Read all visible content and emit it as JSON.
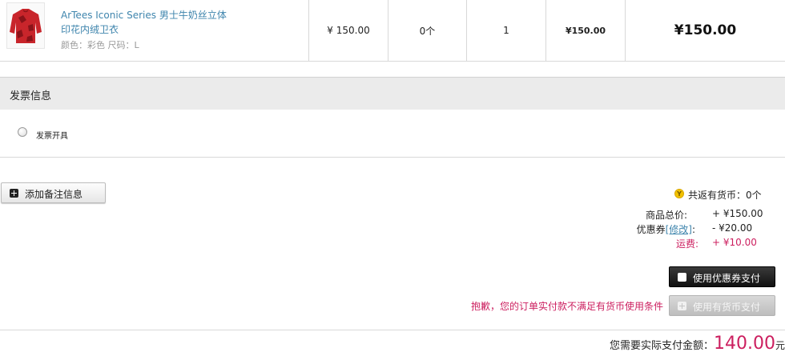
{
  "product": {
    "name": "ArTees Iconic Series 男士牛奶丝立体印花内绒卫衣",
    "color_label": "颜色：",
    "color_value": "彩色",
    "size_label": "尺码：",
    "size_value": "L",
    "price": "¥ 150.00",
    "coins": "0个",
    "quantity": "1",
    "subtotal": "¥150.00",
    "total": "¥150.00"
  },
  "invoice": {
    "title": "发票信息",
    "option_label": "发票开具"
  },
  "remark_button": "添加备注信息",
  "summary": {
    "coin_icon_text": "Y",
    "coin_return": "共返有货币：0个",
    "goods_total_label": "商品总价:",
    "goods_total_value": "+ ¥150.00",
    "coupon_label_pre": "优惠券",
    "coupon_edit": "[修改]",
    "coupon_label_post": ":",
    "coupon_value": "- ¥20.00",
    "shipping_label": "运费:",
    "shipping_value": "+ ¥10.00"
  },
  "buttons": {
    "coupon_pay": "使用优惠券支付",
    "coin_pay": "使用有货币支付"
  },
  "warning": "抱歉，您的订单实付款不满足有货币使用条件",
  "payment": {
    "label": "您需要实际支付金额：",
    "amount": "140.00",
    "unit": "元"
  },
  "colors": {
    "accent_pink": "#cc1f5f",
    "link_blue": "#3f85ad"
  }
}
